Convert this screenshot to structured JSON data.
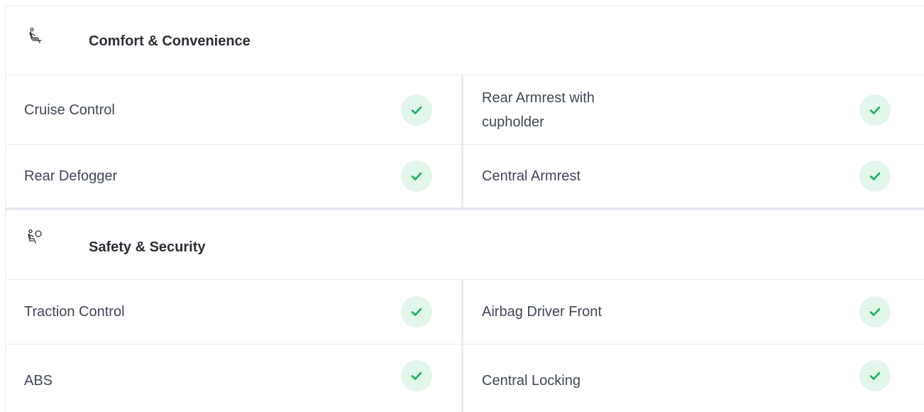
{
  "sections": [
    {
      "icon": "seat-icon",
      "title": "Comfort & Convenience",
      "rows": [
        {
          "left": "Cruise Control",
          "right": "Rear Armrest with cupholder"
        },
        {
          "left": "Rear Defogger",
          "right": "Central Armrest"
        }
      ]
    },
    {
      "icon": "airbag-icon",
      "title": "Safety & Security",
      "rows": [
        {
          "left": "Traction Control",
          "right": "Airbag Driver Front"
        },
        {
          "left": "ABS",
          "right": "Central Locking"
        }
      ]
    }
  ],
  "colors": {
    "check": "#16b55b",
    "check_bg": "#e2f6ea",
    "border": "#e6ebf1"
  }
}
